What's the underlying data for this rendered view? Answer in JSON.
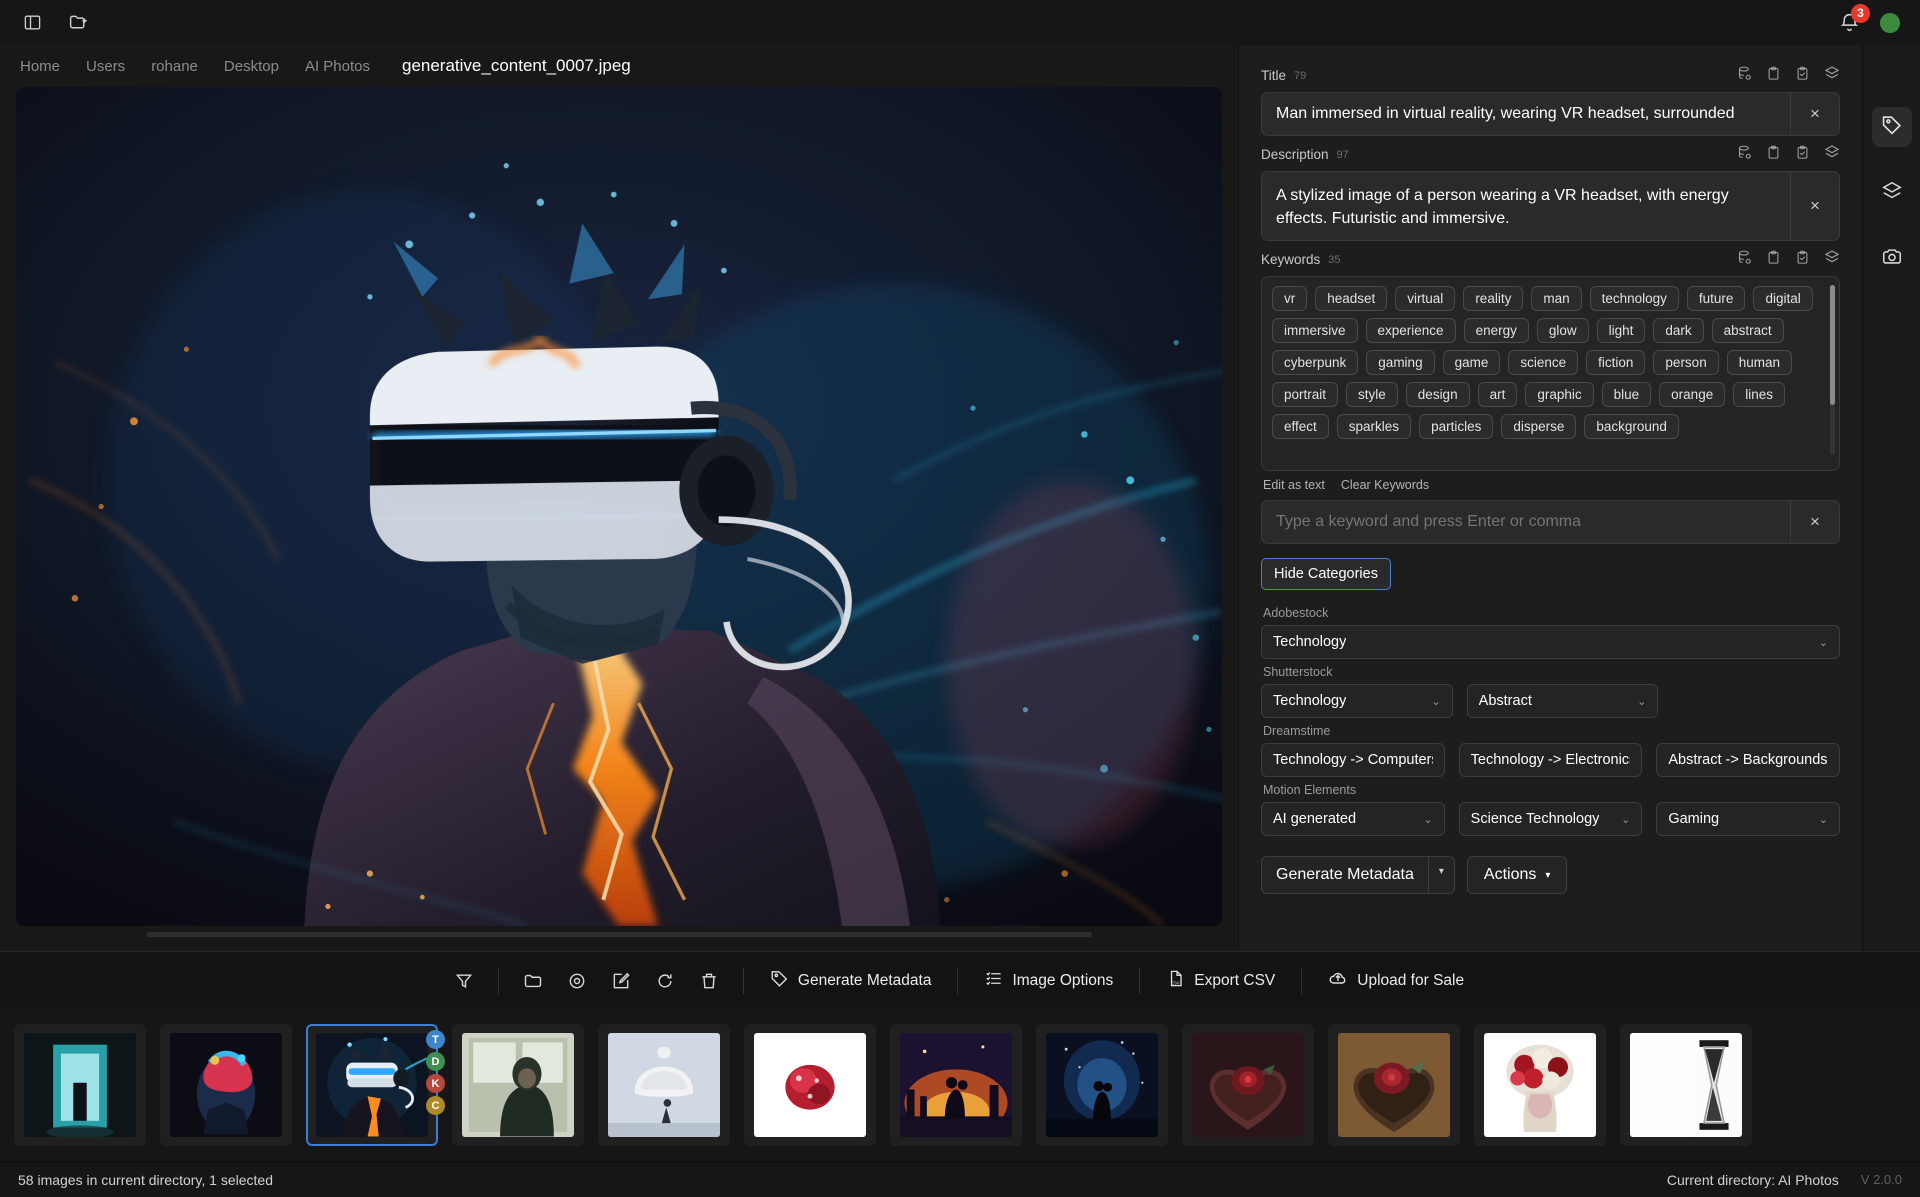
{
  "titlebar": {
    "sidebar_toggle_icon": "panel-left-icon",
    "new_folder_icon": "folder-plus-icon",
    "bell_icon": "bell-icon",
    "notification_count": "3",
    "status_dot_color": "#3c8a3c"
  },
  "breadcrumb": {
    "crumbs": [
      "Home",
      "Users",
      "rohane",
      "Desktop",
      "AI Photos"
    ],
    "current_file": "generative_content_0007.jpeg"
  },
  "metadata": {
    "title": {
      "label": "Title",
      "count": "79",
      "value": "Man immersed in virtual reality, wearing VR headset, surrounded",
      "clear_label": "×"
    },
    "description": {
      "label": "Description",
      "count": "97",
      "value": "A stylized image of a person wearing a VR headset, with energy effects. Futuristic and immersive.",
      "clear_label": "×"
    },
    "keywords": {
      "label": "Keywords",
      "count": "35",
      "items": [
        "vr",
        "headset",
        "virtual",
        "reality",
        "man",
        "technology",
        "future",
        "digital",
        "immersive",
        "experience",
        "energy",
        "glow",
        "light",
        "dark",
        "abstract",
        "cyberpunk",
        "gaming",
        "game",
        "science",
        "fiction",
        "person",
        "human",
        "portrait",
        "style",
        "design",
        "art",
        "graphic",
        "blue",
        "orange",
        "lines",
        "effect",
        "sparkles",
        "particles",
        "disperse",
        "background"
      ],
      "edit_as_text_label": "Edit as text",
      "clear_keywords_label": "Clear Keywords",
      "input_placeholder": "Type a keyword and press Enter or comma",
      "clear_label": "×"
    },
    "field_icons": [
      "database-sync-icon",
      "clipboard-icon",
      "clipboard-check-icon",
      "layers-icon"
    ]
  },
  "categories": {
    "toggle_label": "Hide Categories",
    "groups": [
      {
        "label": "Adobestock",
        "selects": [
          {
            "value": "Technology",
            "chevron": true
          }
        ]
      },
      {
        "label": "Shutterstock",
        "selects": [
          {
            "value": "Technology",
            "chevron": true
          },
          {
            "value": "Abstract",
            "chevron": true
          }
        ]
      },
      {
        "label": "Dreamstime",
        "selects": [
          {
            "value": "Technology -> Computers",
            "chevron": false
          },
          {
            "value": "Technology -> Electronics",
            "chevron": false
          },
          {
            "value": "Abstract -> Backgrounds",
            "chevron": false
          }
        ]
      },
      {
        "label": "Motion Elements",
        "selects": [
          {
            "value": "AI generated",
            "chevron": true
          },
          {
            "value": "Science Technology",
            "chevron": true
          },
          {
            "value": "Gaming",
            "chevron": true
          }
        ]
      }
    ]
  },
  "panel_actions": {
    "generate_metadata_label": "Generate Metadata",
    "generate_metadata_arrow": "▾",
    "actions_label": "Actions",
    "actions_arrow": "▾"
  },
  "rail": {
    "items": [
      {
        "icon": "tag-icon",
        "active": true
      },
      {
        "icon": "layers-icon",
        "active": false
      },
      {
        "icon": "camera-icon",
        "active": false
      }
    ]
  },
  "toolbar": {
    "icons": [
      "filter-icon",
      "folder-icon",
      "eye-icon",
      "edit-icon",
      "refresh-icon",
      "trash-icon"
    ],
    "buttons": [
      {
        "icon": "tag-icon",
        "label": "Generate Metadata"
      },
      {
        "icon": "list-icon",
        "label": "Image Options"
      },
      {
        "icon": "csv-file-icon",
        "label": "Export CSV"
      },
      {
        "icon": "upload-cloud-icon",
        "label": "Upload for Sale"
      }
    ]
  },
  "filmstrip": {
    "thumbnails": [
      {
        "name": "doorway-silhouette",
        "selected": false,
        "badges": []
      },
      {
        "name": "colorful-bust",
        "selected": false,
        "badges": []
      },
      {
        "name": "vr-headset-man",
        "selected": true,
        "badges": [
          {
            "letter": "T",
            "color": "#3d87c9"
          },
          {
            "letter": "D",
            "color": "#3e8f4f"
          },
          {
            "letter": "K",
            "color": "#b4483c"
          },
          {
            "letter": "C",
            "color": "#b08a28"
          }
        ]
      },
      {
        "name": "woman-window",
        "selected": false,
        "badges": []
      },
      {
        "name": "person-under-bell",
        "selected": false,
        "badges": []
      },
      {
        "name": "red-bloom-white",
        "selected": false,
        "badges": []
      },
      {
        "name": "couple-dancing-sunset",
        "selected": false,
        "badges": []
      },
      {
        "name": "couple-night-arch",
        "selected": false,
        "badges": []
      },
      {
        "name": "heart-box-rose-dark",
        "selected": false,
        "badges": []
      },
      {
        "name": "heart-box-rose-gold",
        "selected": false,
        "badges": []
      },
      {
        "name": "rose-bouquet-vase",
        "selected": false,
        "badges": []
      },
      {
        "name": "hourglass-bw",
        "selected": false,
        "badges": []
      }
    ]
  },
  "statusbar": {
    "left_text": "58 images in current directory, 1 selected",
    "current_directory": "Current directory: AI Photos",
    "version": "V 2.0.0"
  }
}
